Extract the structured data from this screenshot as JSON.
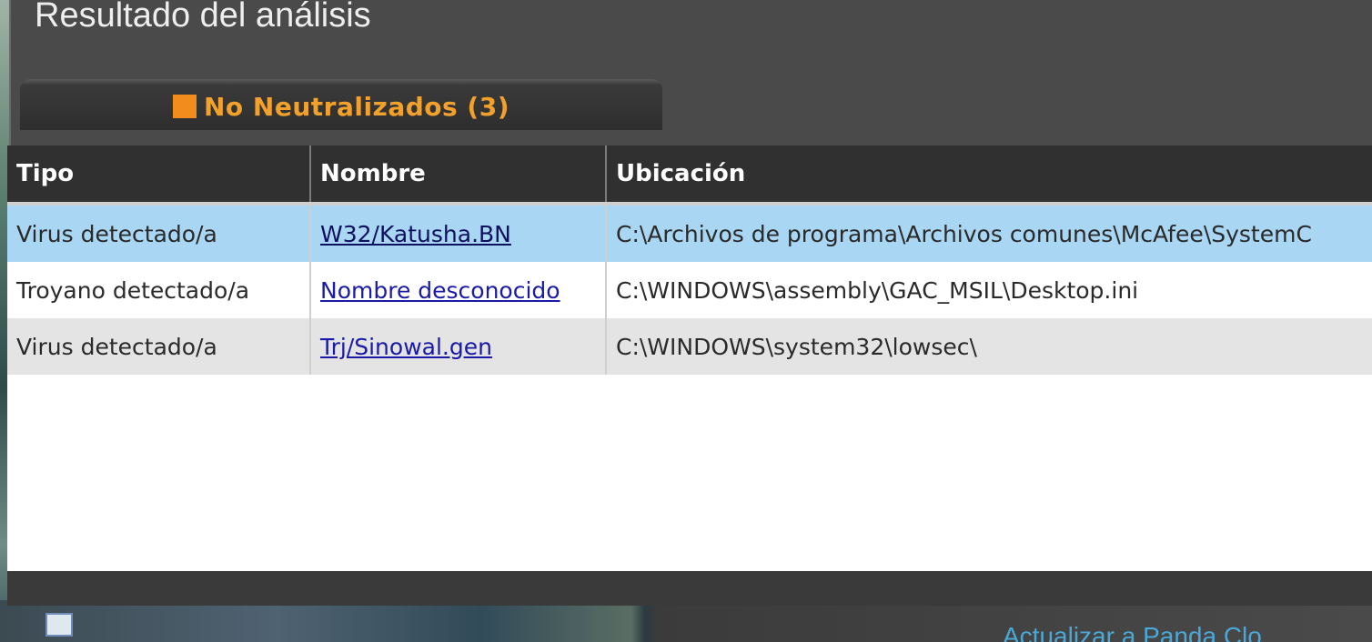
{
  "window": {
    "title": "Resultado del análisis"
  },
  "tab": {
    "label": "No Neutralizados (3)",
    "marker_color": "#f28c1c"
  },
  "table": {
    "columns": [
      "Tipo",
      "Nombre",
      "Ubicación"
    ],
    "rows": [
      {
        "tipo": "Virus detectado/a",
        "nombre": "W32/Katusha.BN",
        "ubicacion": "C:\\Archivos de programa\\Archivos comunes\\McAfee\\SystemC"
      },
      {
        "tipo": "Troyano detectado/a",
        "nombre": "Nombre desconocido",
        "ubicacion": "C:\\WINDOWS\\assembly\\GAC_MSIL\\Desktop.ini"
      },
      {
        "tipo": "Virus detectado/a",
        "nombre": "Trj/Sinowal.gen",
        "ubicacion": "C:\\WINDOWS\\system32\\lowsec\\"
      }
    ],
    "selected_row": 0
  },
  "taskbar": {
    "link_text": "Actualizar a Panda Clo"
  }
}
